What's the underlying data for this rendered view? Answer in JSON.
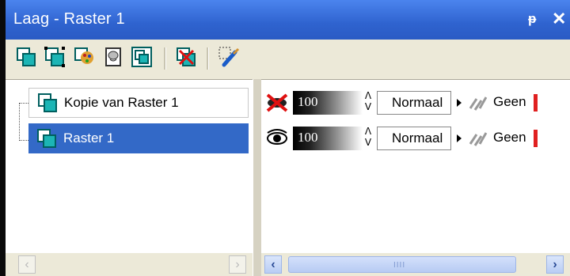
{
  "window": {
    "title": "Laag - Raster 1",
    "pin_icon": "pin-icon",
    "close_icon": "close-icon"
  },
  "toolbar": {
    "buttons": [
      {
        "name": "new-raster-layer-button",
        "icon": "new-raster-layer-icon"
      },
      {
        "name": "new-vector-layer-button",
        "icon": "new-vector-layer-icon"
      },
      {
        "name": "new-art-media-layer-button",
        "icon": "art-media-layer-icon"
      },
      {
        "name": "new-mask-layer-button",
        "icon": "mask-layer-icon"
      },
      {
        "name": "new-layer-group-button",
        "icon": "layer-group-icon"
      },
      {
        "name": "delete-layer-button",
        "icon": "delete-layer-icon"
      },
      {
        "name": "edit-selection-button",
        "icon": "edit-selection-icon"
      }
    ]
  },
  "layers": [
    {
      "name": "Kopie van Raster 1",
      "selected": false,
      "visible": false,
      "opacity": "100",
      "blend_mode": "Normaal",
      "group_link": "Geen"
    },
    {
      "name": "Raster 1",
      "selected": true,
      "visible": true,
      "opacity": "100",
      "blend_mode": "Normaal",
      "group_link": "Geen"
    }
  ],
  "colors": {
    "titlebar": "#2f63cf",
    "selection": "#3369c7",
    "layer_icon": "#00a6a6"
  }
}
